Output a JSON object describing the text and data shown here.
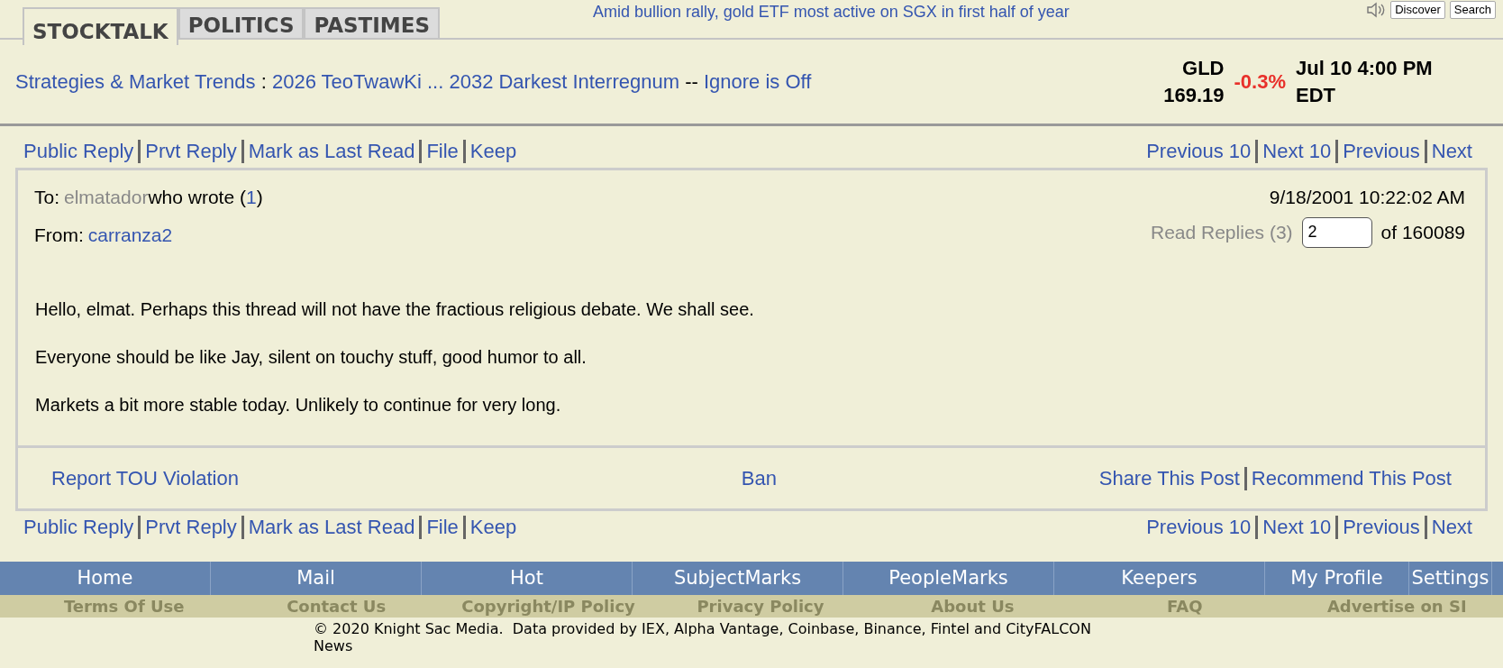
{
  "tabs": [
    {
      "label": "STOCKTALK",
      "selected": true
    },
    {
      "label": "POLITICS",
      "selected": false
    },
    {
      "label": "PASTIMES",
      "selected": false
    }
  ],
  "headline": "Amid bullion rally, gold ETF most active on SGX in first half of year",
  "top_buttons": [
    "Discover",
    "Search"
  ],
  "breadcrumb": {
    "board": "Strategies & Market Trends",
    "separator": ":",
    "thread": "2026 TeoTwawKi ... 2032 Darkest Interregnum",
    "dash": "--",
    "ignore": "Ignore is Off"
  },
  "quote": {
    "symbol": "GLD",
    "price": "169.19",
    "change": "-0.3%",
    "falling": true,
    "time": "Jul 10 4:00 PM EDT"
  },
  "actions_top": {
    "left": [
      "Public Reply",
      "Prvt Reply",
      "Mark as Last Read",
      "File",
      "Keep"
    ],
    "right": [
      "Previous 10",
      "Next 10",
      "Previous",
      "Next"
    ]
  },
  "post": {
    "to_label": "To:",
    "to_user": "elmatador",
    "wrote": "who wrote (",
    "reply_ref": "1",
    "wrote_end": ")",
    "from_label": "From:",
    "from_user": "carranza2",
    "date": "9/18/2001 10:22:02 AM",
    "read_replies": "Read Replies (3)",
    "msg_number": "2",
    "of_total": "of 160089",
    "paragraphs": [
      "Hello, elmat. Perhaps this thread will not have the fractious religious debate. We shall see.",
      "Everyone should be like Jay, silent on touchy stuff, good humor to all.",
      "Markets a bit more stable today. Unlikely to continue for very long."
    ],
    "report": "Report TOU Violation",
    "ban": "Ban",
    "share": "Share This Post",
    "recommend": "Recommend This Post"
  },
  "actions_bottom": {
    "left": [
      "Public Reply",
      "Prvt Reply",
      "Mark as Last Read",
      "File",
      "Keep"
    ],
    "right": [
      "Previous 10",
      "Next 10",
      "Previous",
      "Next"
    ]
  },
  "nav_bar": [
    "Home",
    "Mail",
    "Hot",
    "SubjectMarks",
    "PeopleMarks",
    "Keepers",
    "My Profile",
    "Settings"
  ],
  "footer_links": [
    "Terms Of Use",
    "Contact Us",
    "Copyright/IP Policy",
    "Privacy Policy",
    "About Us",
    "FAQ",
    "Advertise on SI"
  ],
  "copyright": "© 2020 Knight Sac Media.  Data provided by IEX, Alpha Vantage, Coinbase, Binance, Fintel and CityFALCON",
  "copyright_cont": "News"
}
